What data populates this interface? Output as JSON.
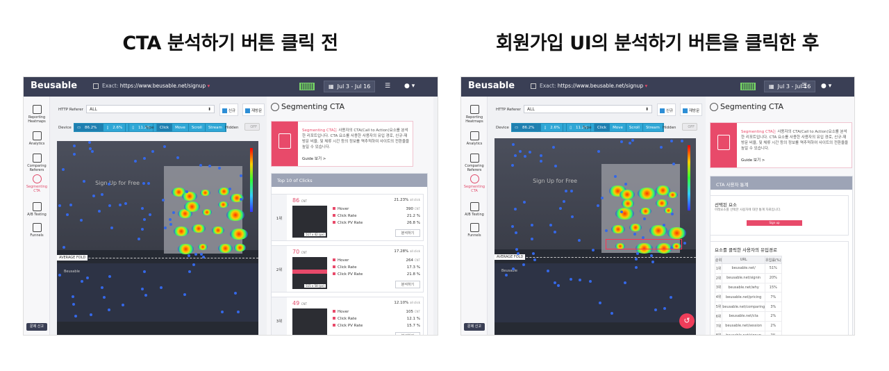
{
  "titles": {
    "left": "CTA 분석하기 버튼 클릭 전",
    "right": "회원가입 UI의 분석하기 버튼을 클릭한 후"
  },
  "app": {
    "logo": "Beusable",
    "url_prefix": "Exact",
    "url": "https://www.beusable.net/signup",
    "date_range": "Jul 3 - Jul 16",
    "accent": "#e84a6a",
    "topbar_color": "#3a3f55"
  },
  "sidebar": [
    {
      "label": "Reporting Heatmaps",
      "icon": "heatmap-icon"
    },
    {
      "label": "Analytics",
      "icon": "analytics-icon"
    },
    {
      "label": "Comparing Referers",
      "icon": "compare-icon"
    },
    {
      "label": "Segmenting CTA",
      "icon": "target-icon",
      "active": true
    },
    {
      "label": "A/B Testing",
      "icon": "ab-testing-icon"
    },
    {
      "label": "Funnels",
      "icon": "funnel-icon"
    }
  ],
  "report_button": "문제 신고",
  "filters": {
    "referer_label": "HTTP Referer",
    "referer_value": "ALL",
    "new_label": "신규",
    "returning_label": "재방문",
    "device_label": "Device",
    "devices": [
      "86.2%",
      "2.6%",
      "11.2%"
    ],
    "type_label": "Type",
    "types": [
      "Click",
      "Move",
      "Scroll",
      "Stream"
    ],
    "hidden_label": "Hidden",
    "toggle": "OFF"
  },
  "heatmap": {
    "fold_label": "AVERAGE FOLD",
    "signup_text": "Sign Up for Free",
    "footer_brand": "Beusable"
  },
  "panel": {
    "title": "Segmenting CTA",
    "info_highlight": "Segmenting CTA는",
    "info_text": " 사용자의 CTA(Call to Action)요소를 분석한 리포트입니다. CTA 요소를 사용한 사용자의 유입 경로, 신규-재방문 비율, 및 체류 시간 등의 정보를 역추적하여 사이트의 전환율을 높일 수 있습니다.",
    "guide": "Guide 보기 >",
    "top10": "Top 10 of Clicks",
    "stats_title": "CTA 사용자 통계"
  },
  "ranks": [
    {
      "rank": "1위",
      "count": "86",
      "unit": "CNT",
      "pct": "21.23%",
      "pct_sub": "all click",
      "hover": "390",
      "click_rate": "21.2",
      "pv_rate": "26.8",
      "size": "517 x 42 (px)",
      "button": "분석하기"
    },
    {
      "rank": "2위",
      "count": "70",
      "unit": "CNT",
      "pct": "17.28%",
      "pct_sub": "all click",
      "hover": "264",
      "click_rate": "17.3",
      "pv_rate": "21.8",
      "size": "515 x 58 (px)",
      "button": "분석하기"
    },
    {
      "rank": "3위",
      "count": "49",
      "unit": "CNT",
      "pct": "12.10%",
      "pct_sub": "all click",
      "hover": "105",
      "click_rate": "12.1",
      "pv_rate": "15.7",
      "size": "",
      "button": "분석하기"
    }
  ],
  "metric_labels": {
    "hover": "Hover",
    "click_rate": "Click Rate",
    "pv_rate": "Click PV Rate"
  },
  "selected": {
    "title": "선택된 요소",
    "desc": "아래요소를 선택한 사용자에 대한 통계 자료입니다.",
    "button": "Sign up"
  },
  "funnel": {
    "title": "요소를 클릭한 사용자의 유입경로",
    "headers": [
      "순위",
      "URL",
      "유입률(%)"
    ],
    "rows": [
      [
        "1위",
        "beusable.net/",
        "51%"
      ],
      [
        "2위",
        "beusable.net/signin",
        "20%"
      ],
      [
        "3위",
        "beusable.net/why",
        "15%"
      ],
      [
        "4위",
        "beusable.net/pricing",
        "7%"
      ],
      [
        "5위",
        "beusable.net/comparing",
        "3%"
      ],
      [
        "6위",
        "beusable.net/cta",
        "2%"
      ],
      [
        "7위",
        "beusable.net/session",
        "2%"
      ],
      [
        "8위",
        "beusable.net/signup",
        "2%"
      ]
    ]
  }
}
